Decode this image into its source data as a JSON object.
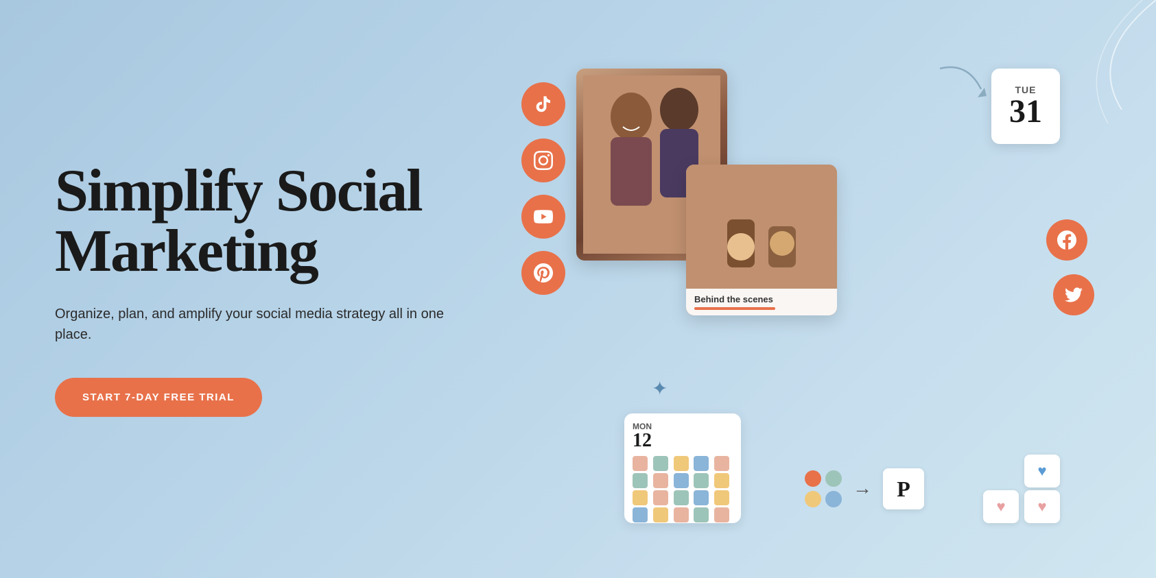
{
  "hero": {
    "headline_line1": "Simplify Social",
    "headline_line2": "Marketing",
    "subheadline": "Organize, plan, and amplify your social media strategy all in one place.",
    "cta_label": "START 7-DAY FREE TRIAL"
  },
  "calendar_main": {
    "day": "TUE",
    "number": "31"
  },
  "calendar_bottom": {
    "day": "MON",
    "number": "12"
  },
  "caption": {
    "text": "Behind the scenes"
  },
  "social_icons": {
    "tiktok": "♪",
    "instagram": "◎",
    "youtube": "▶",
    "pinterest": "℗",
    "facebook": "f",
    "twitter": "𝕋"
  },
  "colors": {
    "bg_from": "#a8c8e0",
    "bg_to": "#d0e6f0",
    "accent": "#e8714a",
    "text_dark": "#1a1a1a",
    "text_mid": "#2a2a2a"
  },
  "cal_grid_colors": [
    "#e8b4a0",
    "#9dc4b8",
    "#f0c87a",
    "#8ab4d8",
    "#e8b4a0",
    "#9dc4b8",
    "#e8b4a0",
    "#8ab4d8",
    "#9dc4b8",
    "#f0c87a",
    "#f0c87a",
    "#e8b4a0",
    "#9dc4b8",
    "#8ab4d8",
    "#f0c87a",
    "#8ab4d8",
    "#f0c87a",
    "#e8b4a0",
    "#9dc4b8",
    "#e8b4a0"
  ],
  "integration_dots_colors": [
    "#e8714a",
    "#9dc4b8",
    "#f0c87a",
    "#8ab4d8"
  ],
  "hearts": {
    "top_right": "💙",
    "mid_right": "🩷",
    "bottom": "🩷"
  }
}
